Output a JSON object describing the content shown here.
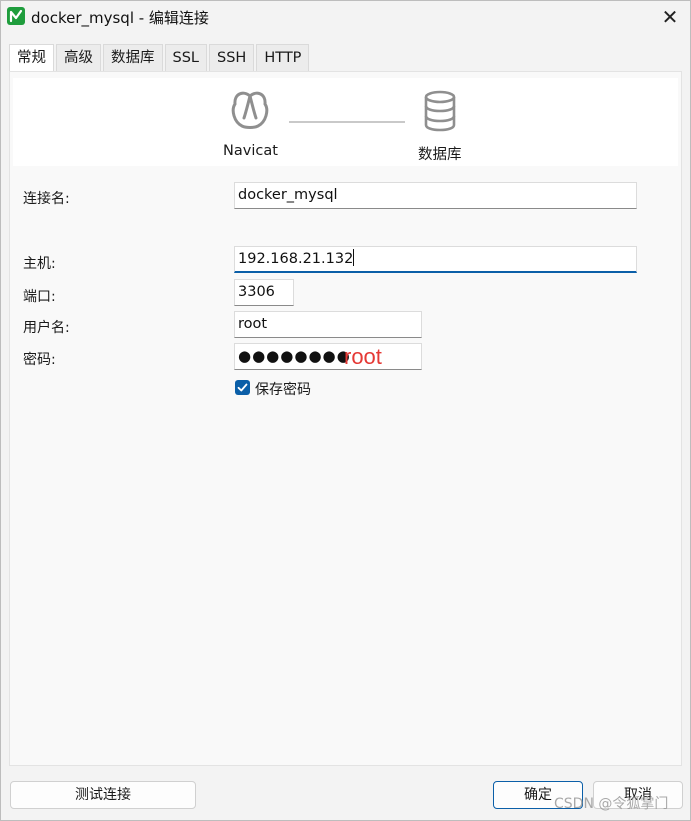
{
  "window": {
    "title": "docker_mysql - 编辑连接",
    "close_symbol": "✕"
  },
  "tabs": [
    {
      "label": "常规",
      "active": true
    },
    {
      "label": "高级",
      "active": false
    },
    {
      "label": "数据库",
      "active": false
    },
    {
      "label": "SSL",
      "active": false
    },
    {
      "label": "SSH",
      "active": false
    },
    {
      "label": "HTTP",
      "active": false
    }
  ],
  "banner": {
    "left_label": "Navicat",
    "left_icon": "navicat-logo-icon",
    "right_label": "数据库",
    "right_icon": "database-icon"
  },
  "form": {
    "connection_name_label": "连接名:",
    "connection_name_value": "docker_mysql",
    "host_label": "主机:",
    "host_value": "192.168.21.132",
    "port_label": "端口:",
    "port_value": "3306",
    "username_label": "用户名:",
    "username_value": "root",
    "password_label": "密码:",
    "password_masked": "●●●●●●●●",
    "password_annotation": "root",
    "save_password_label": "保存密码",
    "save_password_checked": true
  },
  "buttons": {
    "test_connection": "测试连接",
    "ok": "确定",
    "cancel": "取消"
  },
  "watermark": "CSDN @令狐掌门",
  "colors": {
    "accent": "#0b5fa8",
    "annotation": "#e53935",
    "app_icon": "#1f9d3d"
  }
}
